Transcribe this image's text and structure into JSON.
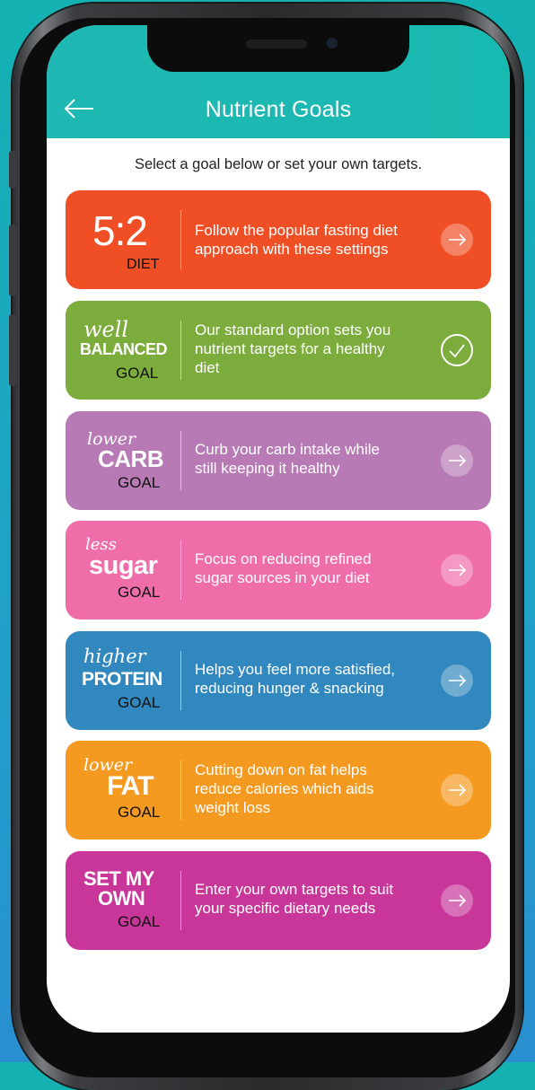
{
  "header": {
    "title": "Nutrient Goals"
  },
  "subtitle": "Select a goal below or set your own targets.",
  "colors": {
    "header_bg": "#1fb8b3",
    "diet_5_2": "#f04e24",
    "well_balanced": "#7cac3c",
    "lower_carb": "#b87ab4",
    "less_sugar": "#ef6ea9",
    "higher_protein": "#3188bf",
    "lower_fat": "#f59a20",
    "set_my_own": "#c8369a"
  },
  "cards": [
    {
      "badge": {
        "big": "5:2",
        "small": "DIET"
      },
      "desc_lines": [
        "Follow the popular fasting diet",
        "approach with these settings"
      ],
      "action_icon": "arrow-right-icon"
    },
    {
      "badge": {
        "script": "well",
        "bold": "BALANCED",
        "goal": "GOAL"
      },
      "desc_lines": [
        "Our standard option sets you",
        "nutrient targets for a healthy",
        "diet"
      ],
      "action_icon": "checkmark-icon",
      "selected": true
    },
    {
      "badge": {
        "script": "lower",
        "bold": "CARB",
        "goal": "GOAL"
      },
      "desc_lines": [
        "Curb your carb intake while",
        "still keeping it healthy"
      ],
      "action_icon": "arrow-right-icon"
    },
    {
      "badge": {
        "script": "less",
        "bold": "sugar",
        "goal": "GOAL"
      },
      "desc_lines": [
        "Focus on reducing refined",
        "sugar sources in your diet"
      ],
      "action_icon": "arrow-right-icon"
    },
    {
      "badge": {
        "script": "higher",
        "bold": "PROTEIN",
        "goal": "GOAL"
      },
      "desc_lines": [
        "Helps you feel more satisfied,",
        "reducing hunger & snacking"
      ],
      "action_icon": "arrow-right-icon"
    },
    {
      "badge": {
        "script": "lower",
        "bold": "FAT",
        "goal": "GOAL"
      },
      "desc_lines": [
        "Cutting down on fat helps",
        "reduce calories which aids",
        "weight loss"
      ],
      "action_icon": "arrow-right-icon"
    },
    {
      "badge": {
        "line1": "SET MY",
        "line2": "OWN",
        "goal": "GOAL"
      },
      "desc_lines": [
        "Enter your own targets to suit",
        "your specific dietary needs"
      ],
      "action_icon": "arrow-right-icon"
    }
  ]
}
